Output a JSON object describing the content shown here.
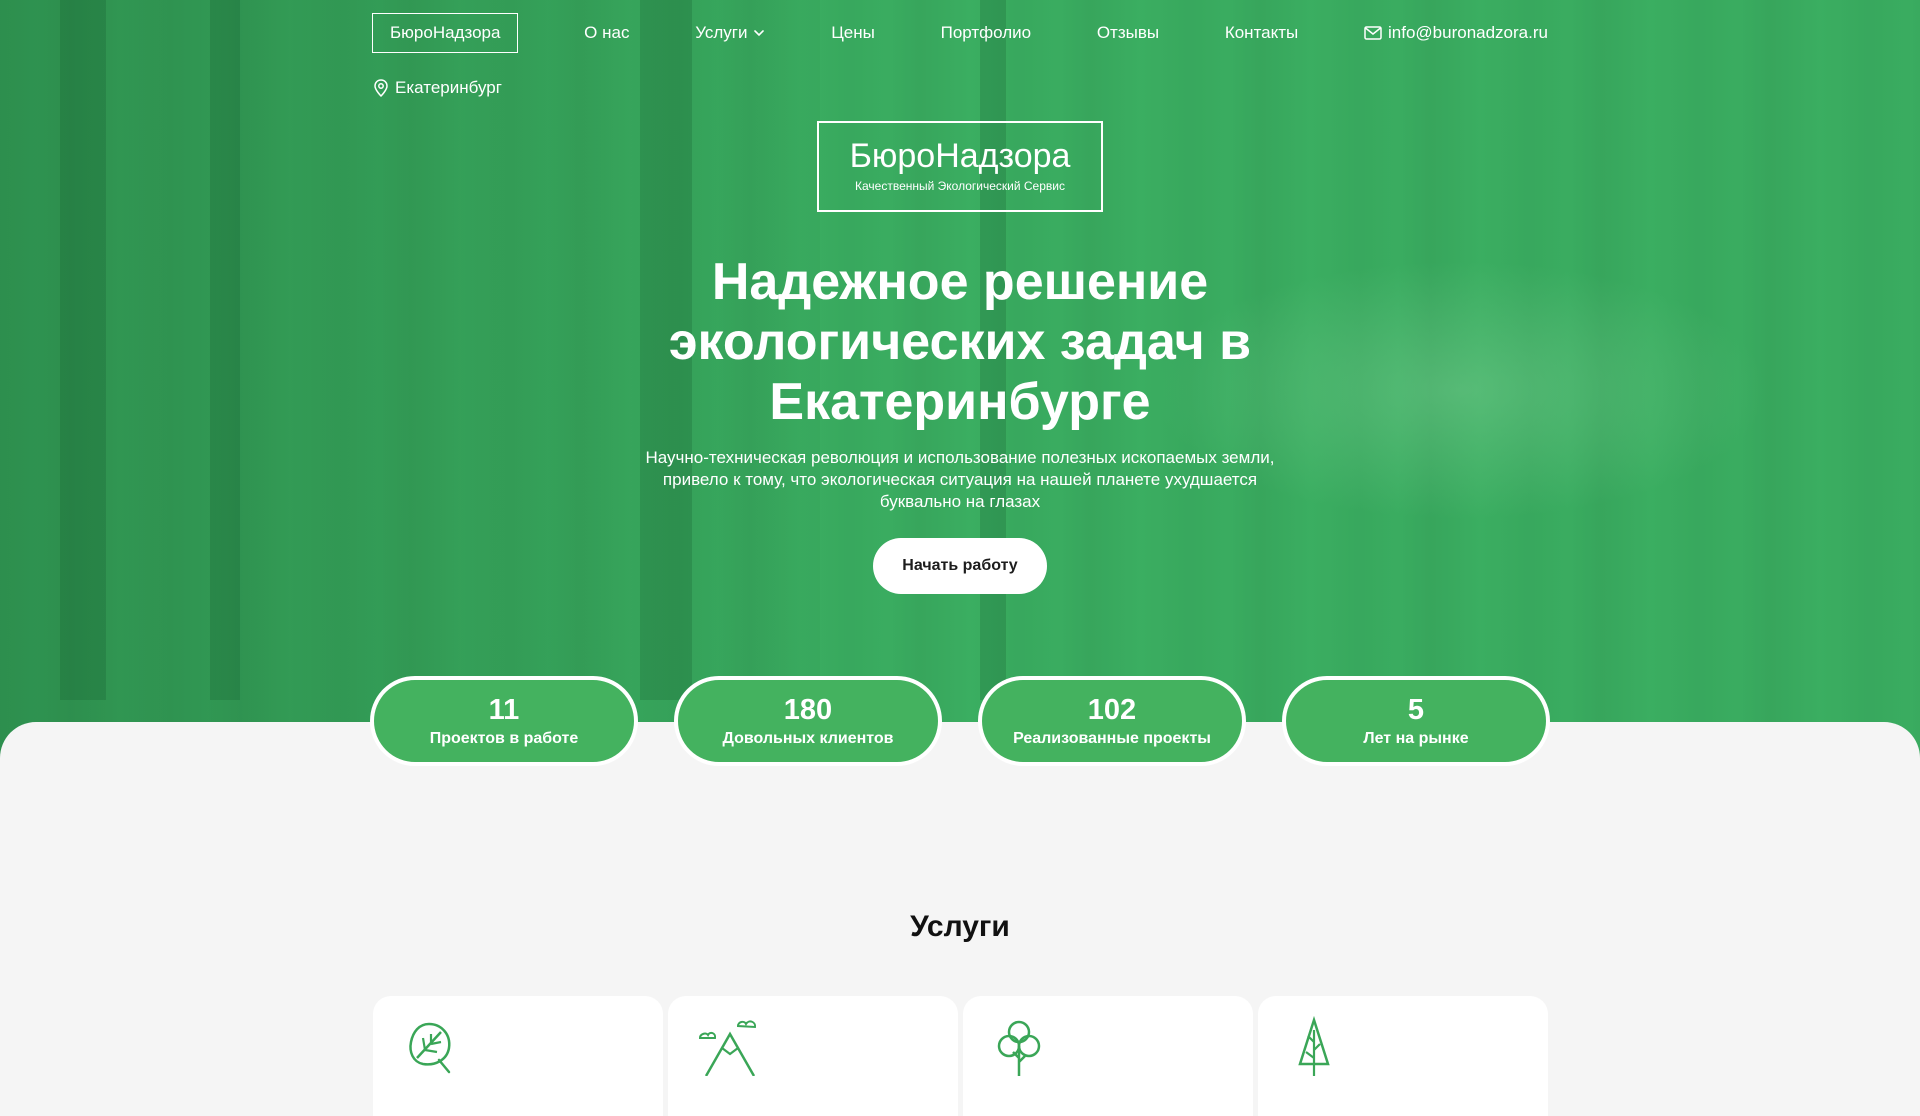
{
  "nav": {
    "brand": "БюроНадзора",
    "about": "О нас",
    "services": "Услуги",
    "prices": "Цены",
    "portfolio": "Портфолио",
    "reviews": "Отзывы",
    "contacts": "Контакты",
    "email": "info@buronadzora.ru"
  },
  "city": "Екатеринбург",
  "logo": {
    "name": "БюроНадзора",
    "tagline": "Качественный Экологический Сервис"
  },
  "hero": {
    "headline": "Надежное решение экологических задач в Екатеринбурге",
    "subtext": "Научно-техническая революция и использование полезных ископаемых земли, привело к тому, что экологическая ситуация на нашей планете ухудшается буквально на глазах",
    "cta": "Начать работу"
  },
  "stats": [
    {
      "value": "11",
      "label": "Проектов в работе"
    },
    {
      "value": "180",
      "label": "Довольных клиентов"
    },
    {
      "value": "102",
      "label": "Реализованные проекты"
    },
    {
      "value": "5",
      "label": "Лет на рынке"
    }
  ],
  "services": {
    "title": "Услуги",
    "cards": [
      {
        "icon": "leaf-icon"
      },
      {
        "icon": "mountain-icon"
      },
      {
        "icon": "tree-icon"
      },
      {
        "icon": "pine-tree-icon"
      }
    ]
  },
  "colors": {
    "accent": "#44b25f",
    "icon_stroke": "#3aa657"
  }
}
